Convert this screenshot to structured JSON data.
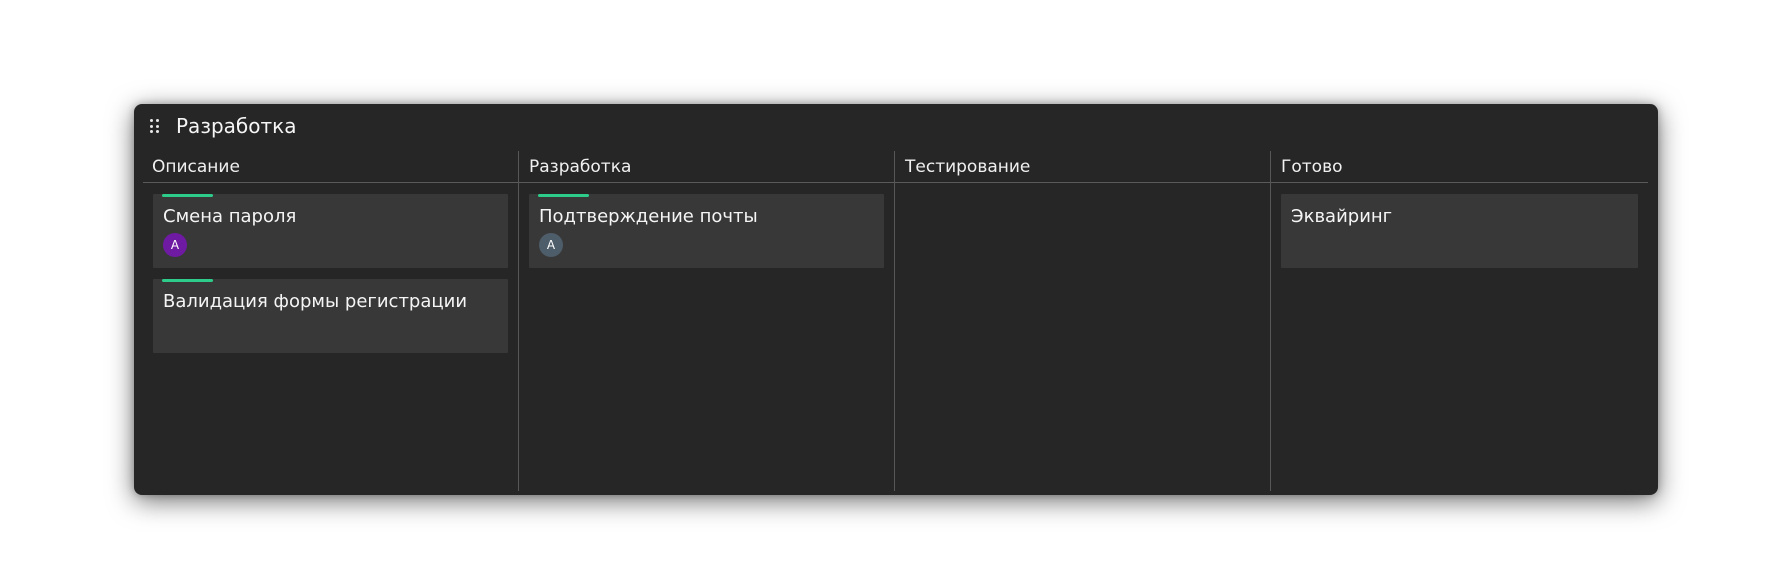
{
  "board": {
    "title": "Разработка"
  },
  "columns": [
    {
      "title": "Описание",
      "cards": [
        {
          "title": "Смена пароля",
          "accent": true,
          "assignee": {
            "initial": "A",
            "color": "#6f1aa3"
          }
        },
        {
          "title": "Валидация формы регистрации",
          "accent": true,
          "assignee": null
        }
      ]
    },
    {
      "title": "Разработка",
      "cards": [
        {
          "title": "Подтверждение почты",
          "accent": true,
          "assignee": {
            "initial": "A",
            "color": "#4e5d6a"
          }
        }
      ]
    },
    {
      "title": "Тестирование",
      "cards": []
    },
    {
      "title": "Готово",
      "cards": [
        {
          "title": "Эквайринг",
          "accent": false,
          "assignee": null
        }
      ]
    }
  ],
  "colors": {
    "accent": "#2ecc8a",
    "board_bg": "#262626",
    "card_bg": "#383838"
  },
  "icons": {
    "drag_handle": "drag-handle-icon"
  }
}
